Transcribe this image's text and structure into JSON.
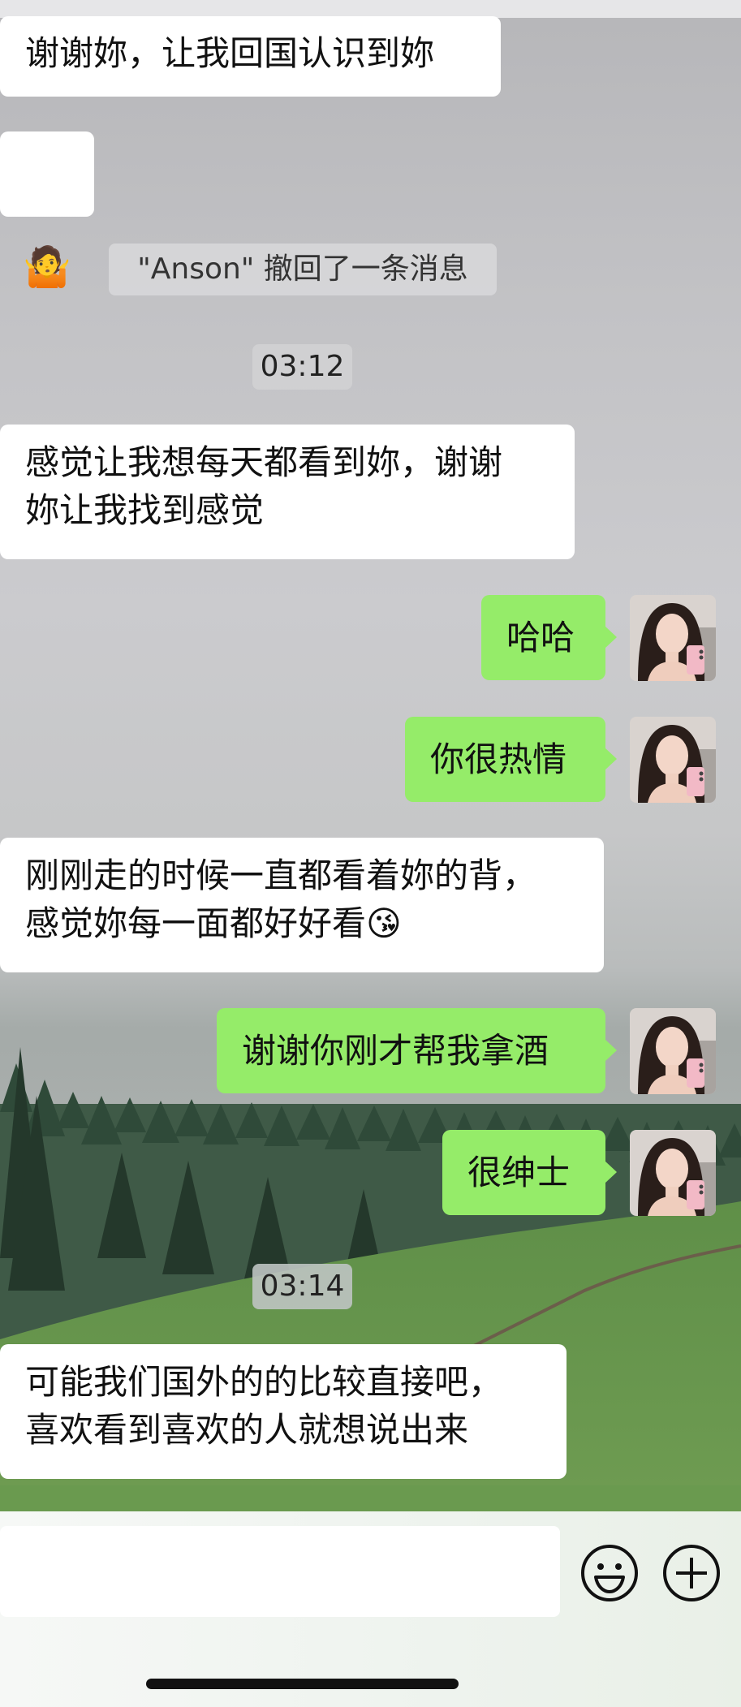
{
  "messages": {
    "m1": "谢谢妳，让我回国认识到妳",
    "m2_emoji": "🤷",
    "recall_notice": "\"Anson\" 撤回了一条消息",
    "time1": "03:12",
    "m3": "感觉让我想每天都看到妳，谢谢\n妳让我找到感觉",
    "m4": "哈哈",
    "m5": "你很热情",
    "m6": "刚刚走的时候一直都看着妳的背，\n感觉妳每一面都好好看😘",
    "m7": "谢谢你刚才帮我拿酒",
    "m8": "很绅士",
    "time2": "03:14",
    "m9": "可能我们国外的的比较直接吧，\n喜欢看到喜欢的人就想说出来"
  },
  "input_bar": {
    "placeholder": "",
    "emoji_button": "emoji-face",
    "more_button": "plus"
  },
  "colors": {
    "incoming_bubble": "#ffffff",
    "outgoing_bubble": "#95ec69"
  }
}
